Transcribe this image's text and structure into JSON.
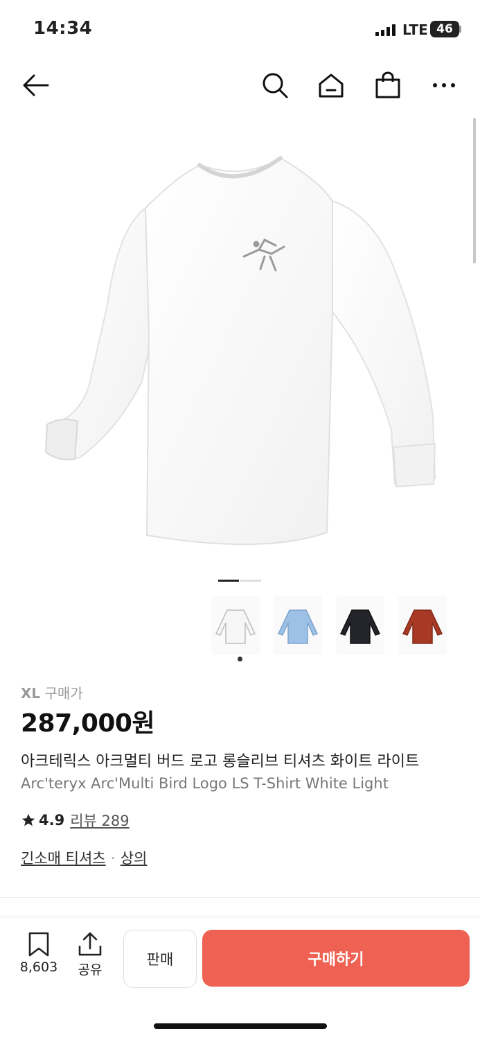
{
  "status_bar": {
    "time": "14:34",
    "network": "LTE",
    "battery": "46"
  },
  "nav": {
    "back_icon": "arrow-left-icon",
    "search_icon": "search-icon",
    "home_icon": "home-icon",
    "cart_icon": "shopping-bag-icon",
    "more_icon": "more-horizontal-icon"
  },
  "product": {
    "size": "XL",
    "price_type": "구매가",
    "price": "287,000원",
    "title_ko": "아크테릭스 아크멀티 버드 로고 롱슬리브 티셔츠 화이트 라이트",
    "title_en": "Arc'teryx Arc'Multi Bird Logo LS T-Shirt White Light",
    "rating": "4.9",
    "review_label": "리뷰 289",
    "categories": [
      "긴소매 티셔츠",
      "상의"
    ],
    "category_sep": "·"
  },
  "thumbnails": [
    {
      "name": "white",
      "color": "#f6f6f6"
    },
    {
      "name": "light-blue",
      "color": "#9cc0e6"
    },
    {
      "name": "black",
      "color": "#23252b"
    },
    {
      "name": "red",
      "color": "#a83a25"
    }
  ],
  "bottom_bar": {
    "bookmark_count": "8,603",
    "share_label": "공유",
    "sell_label": "판매",
    "buy_label": "구매하기"
  },
  "colors": {
    "accent": "#ef6253"
  }
}
